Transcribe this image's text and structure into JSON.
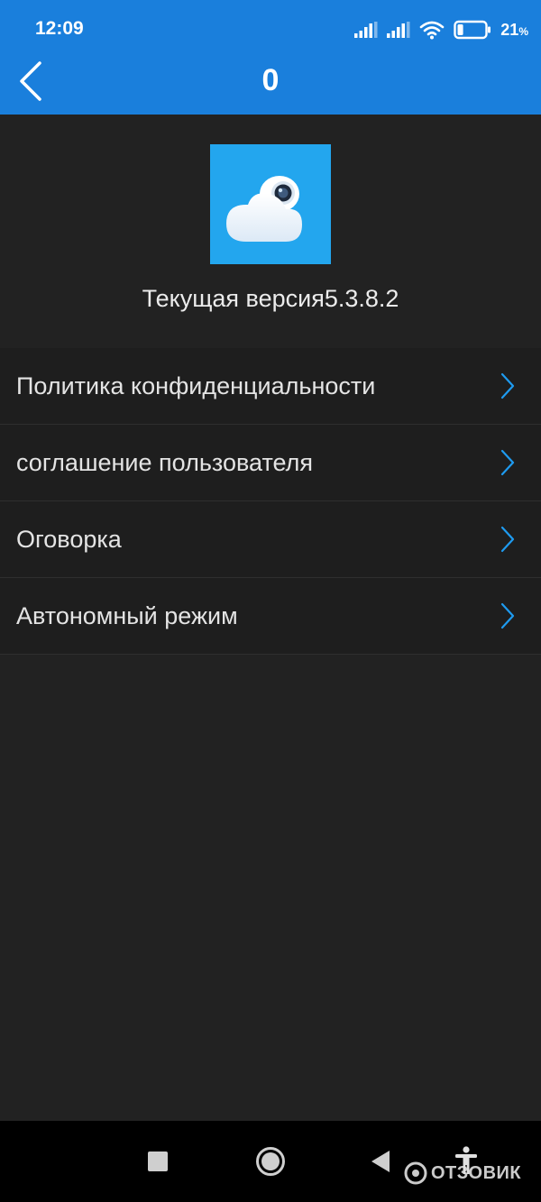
{
  "status_bar": {
    "time": "12:09",
    "battery_percent": "21",
    "battery_suffix": "%",
    "battery_level": 0.21,
    "icons": [
      "signal-icon",
      "signal-icon",
      "wifi-icon",
      "battery-icon"
    ]
  },
  "header": {
    "title": "0",
    "back_icon": "chevron-left-icon",
    "color": "#1a7fdc"
  },
  "app": {
    "logo_icon": "cloud-camera-logo",
    "logo_color": "#23a6ee",
    "version_text": "Текущая версия5.3.8.2"
  },
  "menu": {
    "items": [
      {
        "label": "Политика конфиденциальности"
      },
      {
        "label": "соглашение пользователя"
      },
      {
        "label": "Оговорка"
      },
      {
        "label": "Автономный режим"
      }
    ],
    "chevron_color": "#1e9bf0"
  },
  "nav_bar": {
    "buttons": [
      "recents-square-icon",
      "home-circle-icon",
      "back-triangle-icon",
      "accessibility-icon"
    ]
  },
  "watermark": {
    "text": "ОТЗОВИК"
  }
}
